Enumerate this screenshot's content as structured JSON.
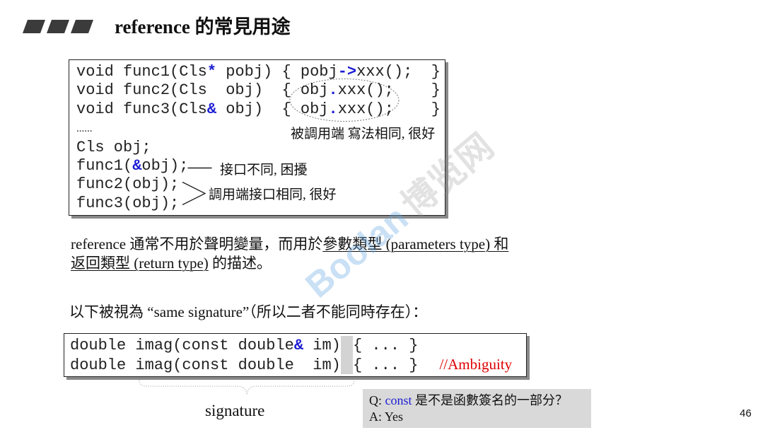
{
  "slide": {
    "title": "reference 的常見用途",
    "page_number": "46"
  },
  "code_block_1": {
    "lines": [
      [
        "void func1(Cls",
        "*",
        " pobj) { pobj",
        "->",
        "xxx();  }"
      ],
      [
        "void func2(Cls  obj)  { obj",
        ".",
        "xxx();    }"
      ],
      [
        "void func3(Cls",
        "&",
        " obj)  { obj",
        ".",
        "xxx();    }"
      ],
      [
        "......"
      ],
      [
        "Cls obj;"
      ],
      [
        "func1(",
        "&",
        "obj);"
      ],
      [
        "func2(obj);"
      ],
      [
        "func3(obj);"
      ]
    ]
  },
  "annotations": {
    "callee_side": "被調用端 寫法相同, 很好",
    "interface_diff": "接口不同, 困擾",
    "caller_side": "調用端接口相同, 很好"
  },
  "paragraph_1": {
    "line1_text": "reference 通常不用於聲明變量，而用於",
    "line1_underlined": "參數類型 (parameters type) 和",
    "line2_underlined": "返回類型 (return type)",
    "line2_text": " 的描述。"
  },
  "paragraph_2": "以下被視為 “same signature”（所以二者不能同時存在）：",
  "code_block_2": {
    "lines": [
      [
        "double imag(const double",
        "&",
        " im)",
        "{ ... }"
      ],
      [
        "double imag(const double  im)",
        "{ ... }"
      ]
    ],
    "comment": "//Ambiguity"
  },
  "signature_label": "signature",
  "qa": {
    "q_prefix": "Q: ",
    "q_keyword": "const",
    "q_rest": " 是不是函數簽名的一部分？",
    "answer": "A: Yes"
  },
  "watermark": {
    "latin": "Boolan",
    "cjk": "博览网"
  },
  "colors": {
    "operator_blue": "#1c1cd4",
    "comment_red": "#e00000",
    "qa_background": "#d9d9d9",
    "title_bars": "#3b3b3b"
  }
}
